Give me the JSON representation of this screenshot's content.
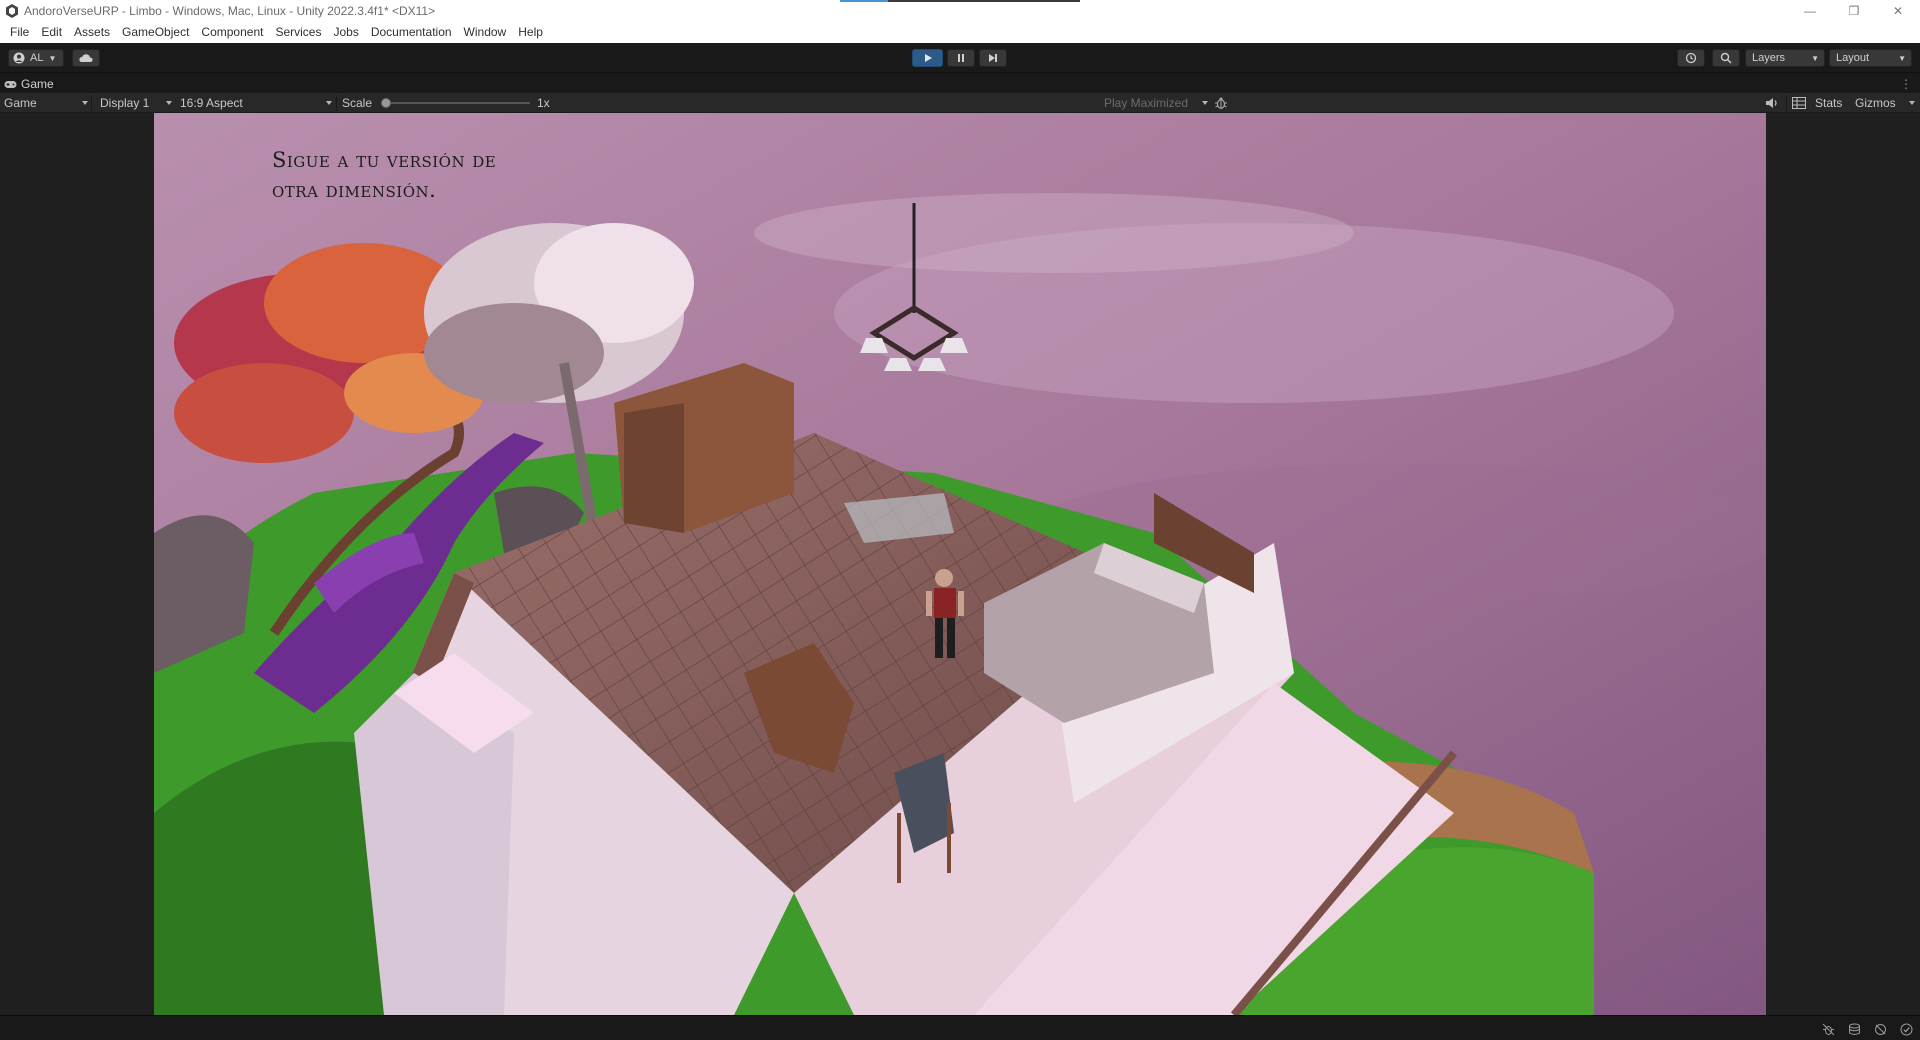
{
  "window": {
    "title": "AndoroVerseURP - Limbo - Windows, Mac, Linux - Unity 2022.3.4f1* <DX11>",
    "progress": 0.2,
    "minimize_glyph": "—",
    "restore_glyph": "❐",
    "close_glyph": "✕"
  },
  "menu": [
    "File",
    "Edit",
    "Assets",
    "GameObject",
    "Component",
    "Services",
    "Jobs",
    "Documentation",
    "Window",
    "Help"
  ],
  "toolbar": {
    "account_label": "AL",
    "layers_label": "Layers",
    "layout_label": "Layout"
  },
  "game_tab": {
    "label": "Game"
  },
  "game_toolbar": {
    "mode": "Game",
    "display": "Display 1",
    "aspect": "16:9 Aspect",
    "scale_label": "Scale",
    "scale_value": "1x",
    "scale_level": 0.0,
    "play_maximized": "Play Maximized",
    "stats": "Stats",
    "gizmos": "Gizmos"
  },
  "game": {
    "objective_line1": "Sigue a tu versión de",
    "objective_line2": "otra dimensión."
  },
  "colors": {
    "play_active": "#2d5b89",
    "editor_bg": "#191919",
    "sky_top": "#b58aa9",
    "sky_bottom": "#8c5f86"
  }
}
